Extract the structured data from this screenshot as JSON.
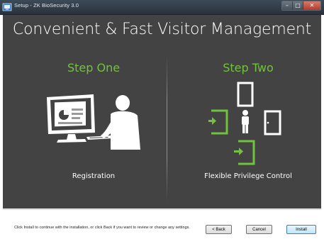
{
  "window": {
    "title": "Setup - ZK BioSecurity 3.0",
    "controls": {
      "minimize": "–",
      "maximize": "□",
      "close": "✕"
    }
  },
  "banner": {
    "headline": "Convenient & Fast Visitor Management",
    "step_one": {
      "label": "Step One",
      "caption": "Registration",
      "icon": "registration-illustration"
    },
    "step_two": {
      "label": "Step Two",
      "caption": "Flexible Privilege Control",
      "icon": "privilege-control-illustration"
    },
    "colors": {
      "background": "#434343",
      "accent": "#72c23f",
      "text": "#ffffff"
    }
  },
  "footer": {
    "info_text": "Click Install to continue with the installation, or click Back if you want to review or change any settings.",
    "buttons": {
      "back": "< Back",
      "cancel": "Cancel",
      "install": "Install"
    }
  }
}
